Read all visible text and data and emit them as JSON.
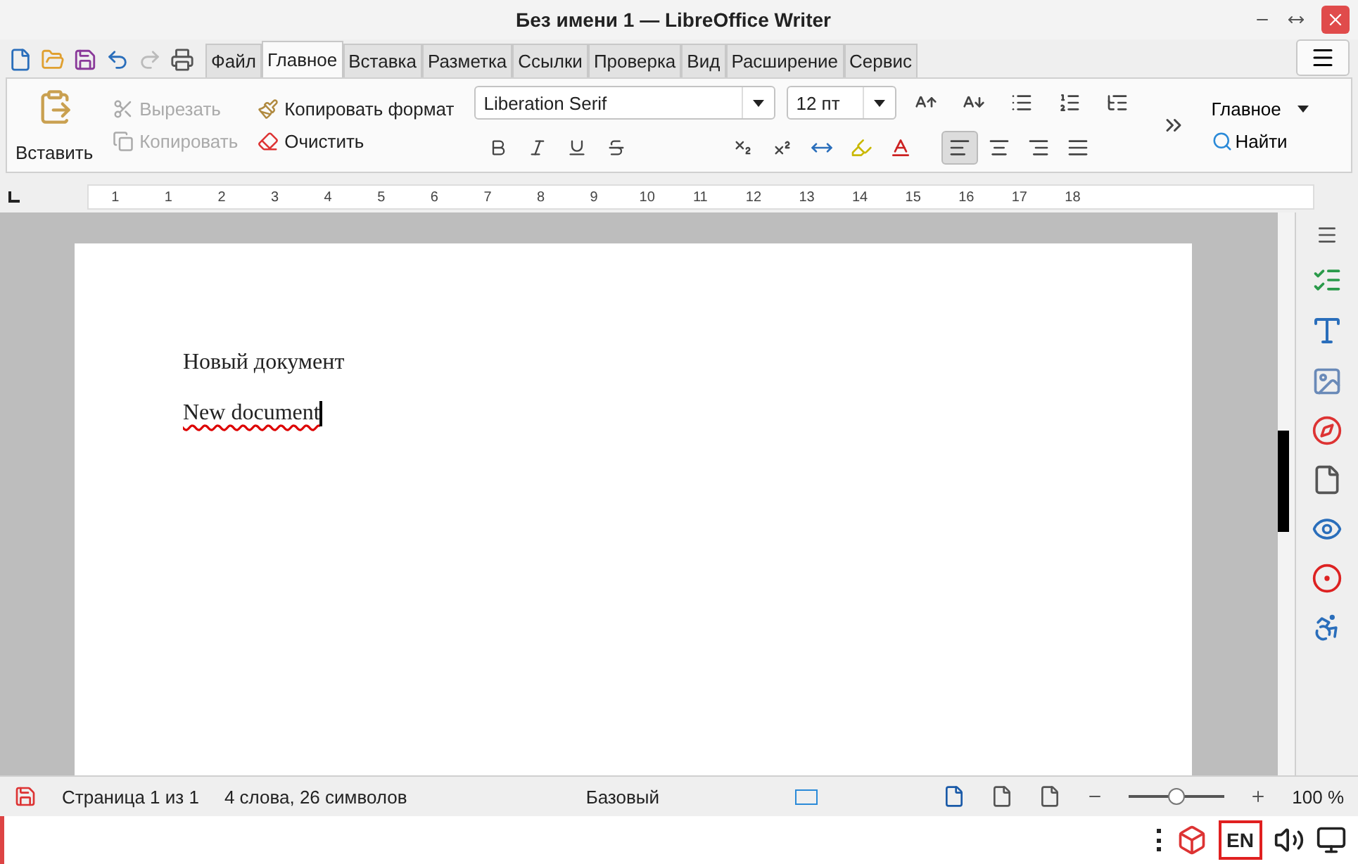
{
  "window": {
    "title": "Без имени 1 — LibreOffice Writer"
  },
  "menu_tabs": [
    {
      "label": "Файл",
      "selected": false
    },
    {
      "label": "Главное",
      "selected": true
    },
    {
      "label": "Вставка",
      "selected": false
    },
    {
      "label": "Разметка",
      "selected": false
    },
    {
      "label": "Ссылки",
      "selected": false
    },
    {
      "label": "Проверка",
      "selected": false
    },
    {
      "label": "Вид",
      "selected": false
    },
    {
      "label": "Расширение",
      "selected": false
    },
    {
      "label": "Сервис",
      "selected": false
    }
  ],
  "toolbar": {
    "paste": "Вставить",
    "clipboard": [
      {
        "kind": "cut",
        "label": "Вырезать",
        "disabled": true
      },
      {
        "kind": "copy",
        "label": "Копировать",
        "disabled": true
      }
    ],
    "clone_format": "Копировать формат",
    "clear": "Очистить",
    "font_name": "Liberation Serif",
    "font_size": "12 пт",
    "alignments": [
      {
        "kind": "left",
        "selected": true
      },
      {
        "kind": "center",
        "selected": false
      },
      {
        "kind": "right",
        "selected": false
      },
      {
        "kind": "justify",
        "selected": false
      }
    ],
    "style_name": "Главное",
    "find": "Найти"
  },
  "ruler": {
    "labels": [
      "1",
      "1",
      "2",
      "3",
      "4",
      "5",
      "6",
      "7",
      "8",
      "9",
      "10",
      "11",
      "12",
      "13",
      "14",
      "15",
      "16",
      "17",
      "18"
    ]
  },
  "document": {
    "paragraphs": [
      {
        "text": "Новый документ",
        "misspelled": false
      },
      {
        "text": "New document",
        "misspelled": true
      }
    ]
  },
  "status_bar": {
    "page": "Страница 1 из 1",
    "words": "4 слова, 26 символов",
    "page_style": "Базовый",
    "zoom": {
      "level": 0.5
    },
    "zoom_percent": "100 %"
  },
  "taskbar": {
    "language": "EN"
  }
}
